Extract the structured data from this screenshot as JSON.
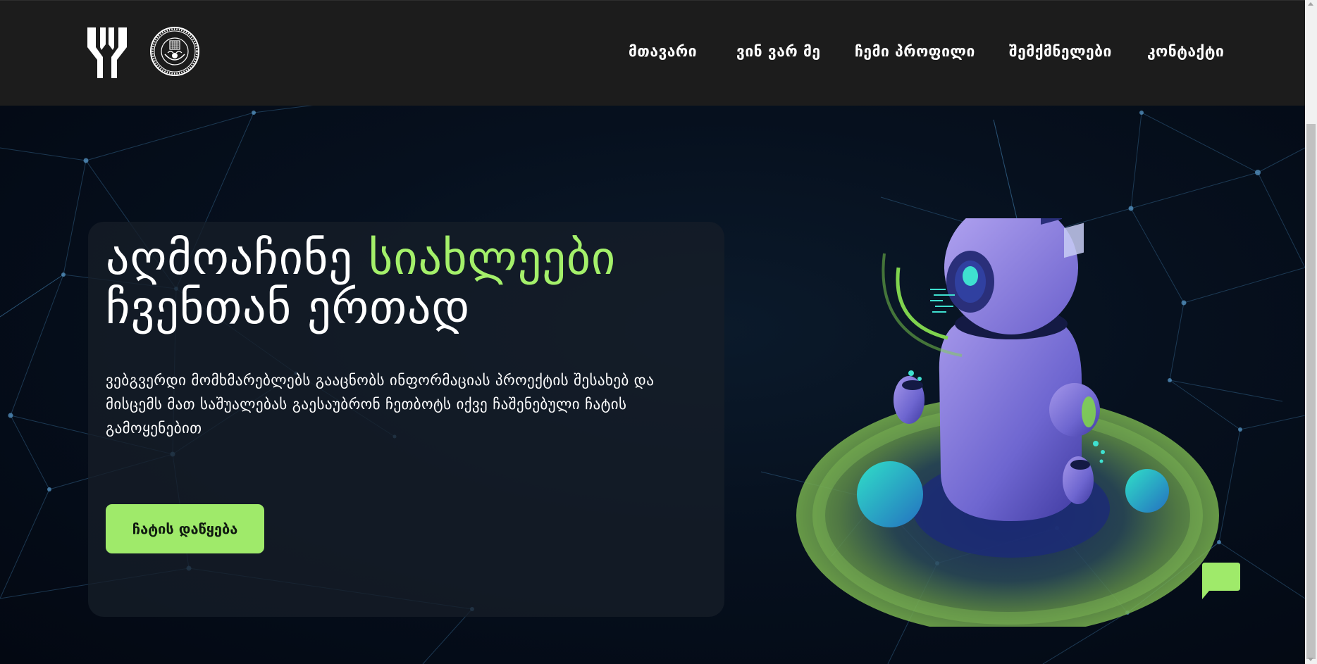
{
  "nav": {
    "items": [
      {
        "label": "მთავარი"
      },
      {
        "label": "ვინ ვარ მე"
      },
      {
        "label": "ჩემი პროფილი"
      },
      {
        "label": "შემქმნელები"
      },
      {
        "label": "კონტაქტი"
      }
    ]
  },
  "hero": {
    "headline_part1": "აღმოაჩინე ",
    "headline_accent": "სიახლეები",
    "headline_part2": "ჩვენთან ერთად",
    "description": "ვებგვერდი მომხმარებლებს გააცნობს ინფორმაციას პროექტის შესახებ და მისცემს მათ საშუალებას გაესაუბრონ ჩეთბოტს იქვე ჩაშენებული ჩატის გამოყენებით",
    "cta_label": "ჩატის დაწყება"
  },
  "icons": {
    "logo": "brand-logo-icon",
    "seal": "university-seal-icon",
    "robot": "robot-illustration",
    "chat": "chat-bubble-icon"
  },
  "colors": {
    "header_bg": "#1c1c1c",
    "hero_bg": "#040b16",
    "accent": "#a4f06a",
    "robot_purple": "#8a7bd8",
    "teal": "#2fd3c6"
  }
}
